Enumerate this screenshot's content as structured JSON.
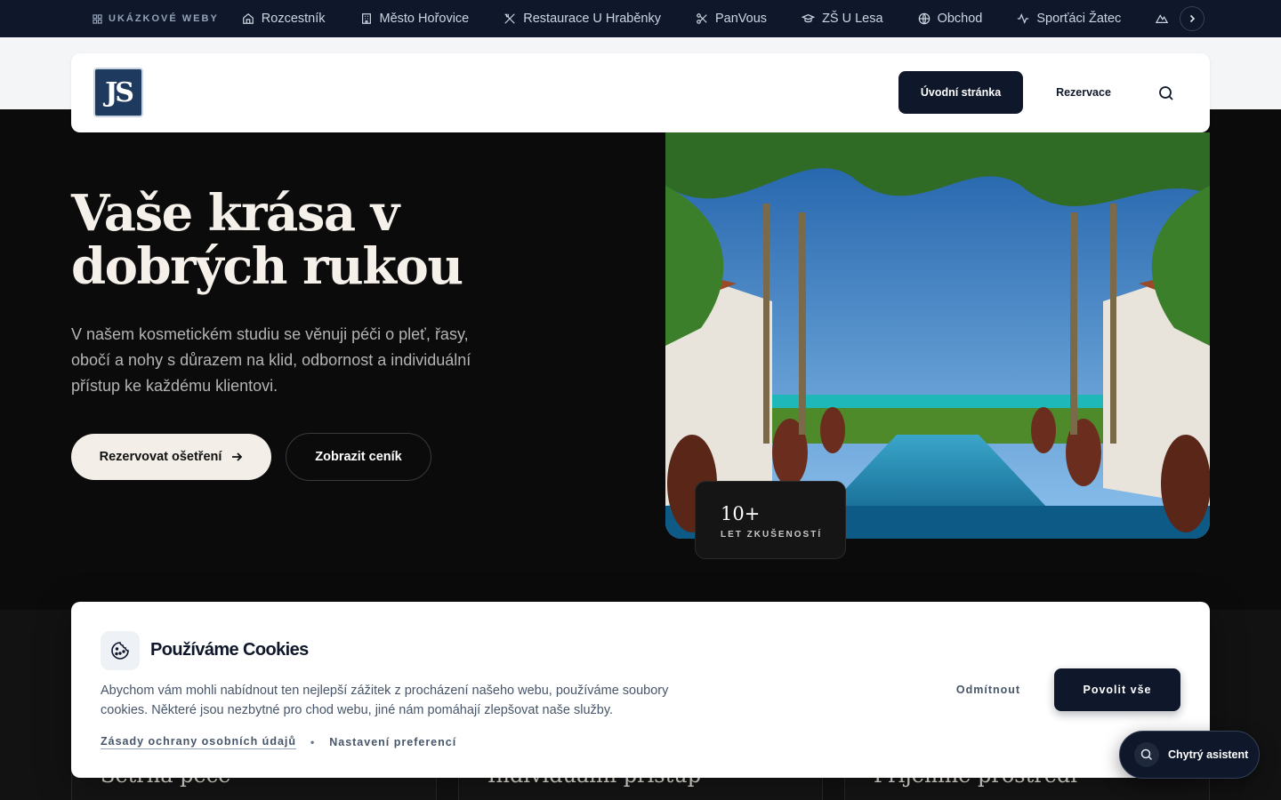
{
  "topbar": {
    "label": "UKÁZKOVÉ WEBY",
    "items": [
      {
        "label": "Rozcestník",
        "icon": "home-icon"
      },
      {
        "label": "Město Hořovice",
        "icon": "building-icon"
      },
      {
        "label": "Restaurace U Hraběnky",
        "icon": "utensils-icon"
      },
      {
        "label": "PanVous",
        "icon": "scissors-icon"
      },
      {
        "label": "ZŠ U Lesa",
        "icon": "graduation-cap-icon"
      },
      {
        "label": "Obchod",
        "icon": "globe-icon"
      },
      {
        "label": "Sporťáci Žatec",
        "icon": "activity-icon"
      }
    ]
  },
  "header": {
    "logo_text": "JS",
    "nav": {
      "home": "Úvodní stránka",
      "reservation": "Rezervace"
    }
  },
  "hero": {
    "title": "Vaše krása v dobrých rukou",
    "text": "V našem kosmetickém studiu se věnuji péči o pleť, řasy, obočí a nohy s důrazem na klid, odbornost a individuální přístup ke každému klientovi.",
    "primary_button": "Rezervovat ošetření",
    "secondary_button": "Zobrazit ceník",
    "badge": {
      "number": "10+",
      "label": "LET ZKUŠENOSTÍ"
    }
  },
  "features": [
    "Šetrná péče",
    "Individuální přístup",
    "Příjemné prostředí"
  ],
  "cookie": {
    "title": "Používáme Cookies",
    "text": "Abychom vám mohli nabídnout ten nejlepší zážitek z procházení našeho webu, používáme soubory cookies. Některé jsou nezbytné pro chod webu, jiné nám pomáhají zlepšovat naše služby.",
    "privacy_link": "Zásady ochrany osobních údajů",
    "preferences_link": "Nastavení preferencí",
    "reject": "Odmítnout",
    "accept": "Povolit vše"
  },
  "assistant": {
    "label": "Chytrý asistent"
  },
  "colors": {
    "navy": "#0f172a",
    "cream": "#f3efe8",
    "dark": "#0b0b0c"
  }
}
